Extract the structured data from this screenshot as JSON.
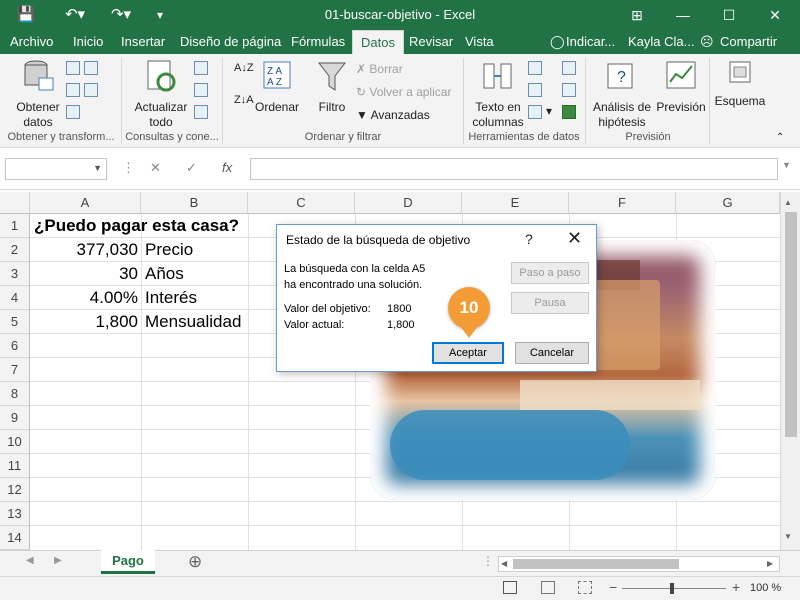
{
  "titlebar": {
    "title": "01-buscar-objetivo  -  Excel",
    "restore_icon": "restore-icon",
    "minimize": "—",
    "maximize": "☐",
    "close": "✕"
  },
  "menu": {
    "tabs": [
      "Archivo",
      "Inicio",
      "Insertar",
      "Diseño de página",
      "Fórmulas",
      "Datos",
      "Revisar",
      "Vista"
    ],
    "active_tab": "Datos",
    "tell_me": "Indicar...",
    "user": "Kayla Cla...",
    "share": "Compartir"
  },
  "ribbon": {
    "obtener": "Obtener datos",
    "actualizar": "Actualizar todo",
    "ordenar": "Ordenar",
    "filtro": "Filtro",
    "borrar": "Borrar",
    "volver": "Volver a aplicar",
    "avanzadas": "Avanzadas",
    "texto_columnas": "Texto en columnas",
    "analisis": "Análisis de hipótesis",
    "prevision": "Previsión",
    "esquema": "Esquema",
    "groups": [
      "Obtener y transform...",
      "Consultas y cone...",
      "Ordenar y filtrar",
      "Herramientas de datos",
      "Previsión"
    ]
  },
  "formula_bar": {
    "cancel": "✕",
    "enter": "✓",
    "fx": "fx"
  },
  "grid": {
    "columns": [
      "A",
      "B",
      "C",
      "D",
      "E",
      "F",
      "G"
    ],
    "rows": [
      "1",
      "2",
      "3",
      "4",
      "5",
      "6",
      "7",
      "8",
      "9",
      "10",
      "11",
      "12",
      "13",
      "14"
    ],
    "a1": "¿Puedo pagar esta casa?",
    "a2": "377,030",
    "b2": "Precio",
    "a3": "30",
    "b3": "Años",
    "a4": "4.00%",
    "b4": "Interés",
    "a5": "1,800",
    "b5": "Mensualidad"
  },
  "dialog": {
    "title": "Estado de la búsqueda de objetivo",
    "help": "?",
    "close": "✕",
    "line1": "La búsqueda con la celda A5",
    "line2": "ha encontrado una solución.",
    "target_label": "Valor del objetivo:",
    "target_value": "1800",
    "current_label": "Valor actual:",
    "current_value": "1,800",
    "step_button": "Paso a paso",
    "pause_button": "Pausa",
    "accept_button": "Aceptar",
    "cancel_button": "Cancelar"
  },
  "badge": "10",
  "sheet_tabs": {
    "active": "Pago",
    "add": "⊕"
  },
  "status": {
    "zoom": "100 %"
  }
}
